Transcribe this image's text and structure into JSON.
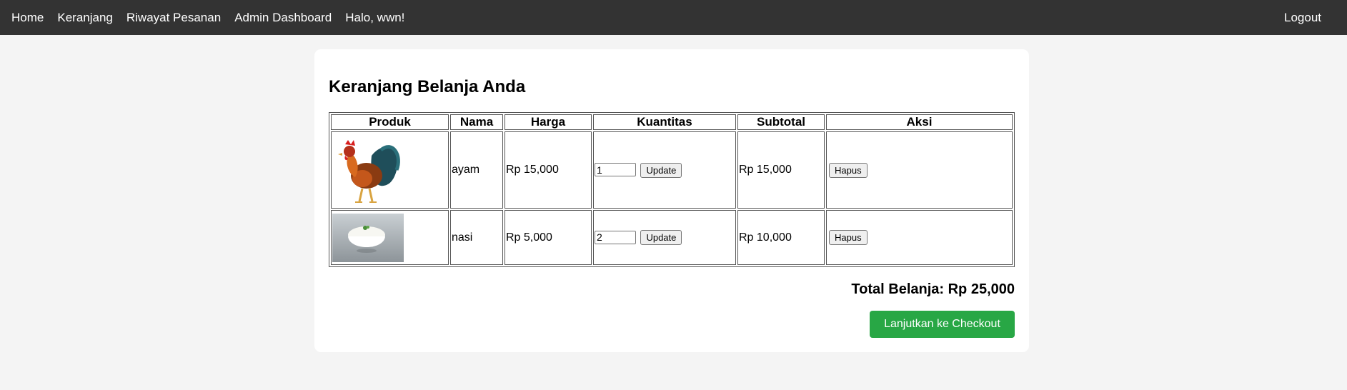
{
  "nav": {
    "links": [
      "Home",
      "Keranjang",
      "Riwayat Pesanan",
      "Admin Dashboard"
    ],
    "greeting": "Halo, wwn!",
    "logout": "Logout"
  },
  "cart": {
    "title": "Keranjang Belanja Anda",
    "headers": [
      "Produk",
      "Nama",
      "Harga",
      "Kuantitas",
      "Subtotal",
      "Aksi"
    ],
    "rows": [
      {
        "name": "ayam",
        "price": "Rp 15,000",
        "qty": "1",
        "subtotal": "Rp 15,000",
        "update": "Update",
        "delete": "Hapus",
        "image": "rooster-image"
      },
      {
        "name": "nasi",
        "price": "Rp 5,000",
        "qty": "2",
        "subtotal": "Rp 10,000",
        "update": "Update",
        "delete": "Hapus",
        "image": "rice-bowl-image"
      }
    ],
    "total": "Total Belanja: Rp 25,000",
    "checkout": "Lanjutkan ke Checkout"
  },
  "colors": {
    "navbar": "#333333",
    "checkout": "#28a745",
    "background": "#f4f4f4"
  }
}
